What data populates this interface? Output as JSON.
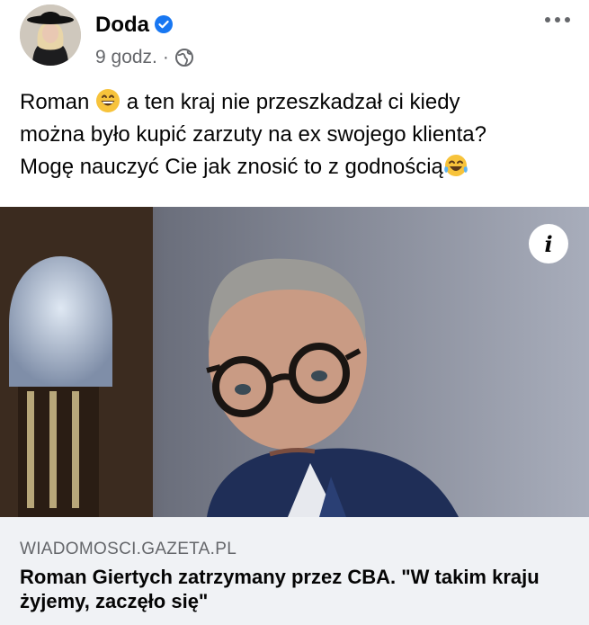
{
  "post": {
    "author": "Doda",
    "time": "9 godz.",
    "separator": "·",
    "text_line1_before": "Roman",
    "text_line1_after": "a ten kraj nie przeszkadzał ci kiedy",
    "text_line2": "można było kupić zarzuty na ex swojego klienta?",
    "text_line3": "Mogę nauczyć Cie jak znosić to z godnością"
  },
  "link_preview": {
    "domain": "WIADOMOSCI.GAZETA.PL",
    "title": "Roman Giertych zatrzymany przez CBA. \"W takim kraju żyjemy, zaczęło się\"",
    "info_label": "i"
  },
  "icons": {
    "verified": "verified-badge-icon",
    "globe": "globe-icon",
    "more": "more-options-icon",
    "emoji1": "grinning-face-emoji",
    "emoji2": "tears-of-joy-emoji",
    "info": "info-icon"
  },
  "colors": {
    "verified_blue": "#1877f2",
    "secondary_text": "#65676b",
    "preview_bg": "#f0f2f5"
  }
}
